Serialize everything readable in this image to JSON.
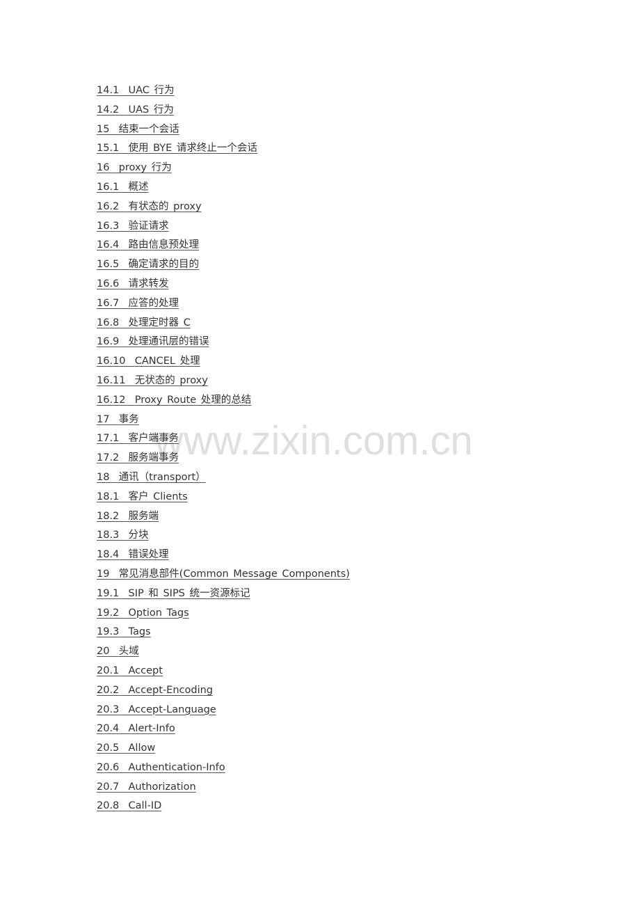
{
  "toc": {
    "items": [
      {
        "number": "14.1",
        "title": "UAC 行为"
      },
      {
        "number": "14.2",
        "title": "UAS 行为"
      },
      {
        "number": "15",
        "title": "结束一个会话"
      },
      {
        "number": "15.1",
        "title": "使用 BYE 请求终止一个会话"
      },
      {
        "number": "16",
        "title": "proxy 行为"
      },
      {
        "number": "16.1",
        "title": "概述"
      },
      {
        "number": "16.2",
        "title": "有状态的 proxy"
      },
      {
        "number": "16.3",
        "title": "验证请求"
      },
      {
        "number": "16.4",
        "title": "路由信息预处理"
      },
      {
        "number": "16.5",
        "title": "确定请求的目的"
      },
      {
        "number": "16.6",
        "title": "请求转发"
      },
      {
        "number": "16.7",
        "title": "应答的处理"
      },
      {
        "number": "16.8",
        "title": "处理定时器 C"
      },
      {
        "number": "16.9",
        "title": "处理通讯层的错误"
      },
      {
        "number": "16.10",
        "title": "CANCEL 处理"
      },
      {
        "number": "16.11",
        "title": "无状态的 proxy"
      },
      {
        "number": "16.12",
        "title": "Proxy Route 处理的总结"
      },
      {
        "number": "17",
        "title": "事务"
      },
      {
        "number": "17.1",
        "title": "客户端事务"
      },
      {
        "number": "17.2",
        "title": "服务端事务"
      },
      {
        "number": "18",
        "title": "通讯（transport）"
      },
      {
        "number": "18.1",
        "title": "客户 Clients"
      },
      {
        "number": "18.2",
        "title": "服务端"
      },
      {
        "number": "18.3",
        "title": "分块"
      },
      {
        "number": "18.4",
        "title": "错误处理"
      },
      {
        "number": "19",
        "title": "常见消息部件(Common Message Components)"
      },
      {
        "number": "19.1",
        "title": "SIP 和 SIPS 统一资源标记"
      },
      {
        "number": "19.2",
        "title": "Option Tags"
      },
      {
        "number": "19.3",
        "title": "Tags"
      },
      {
        "number": "20",
        "title": "头域"
      },
      {
        "number": "20.1",
        "title": "Accept"
      },
      {
        "number": "20.2",
        "title": "Accept-Encoding"
      },
      {
        "number": "20.3",
        "title": "Accept-Language"
      },
      {
        "number": "20.4",
        "title": "Alert-Info"
      },
      {
        "number": "20.5",
        "title": "Allow"
      },
      {
        "number": "20.6",
        "title": "Authentication-Info"
      },
      {
        "number": "20.7",
        "title": "Authorization"
      },
      {
        "number": "20.8",
        "title": "Call-ID"
      }
    ]
  },
  "watermark": {
    "text": "www.zixin.com.cn"
  },
  "colors": {
    "text": "#333333",
    "background": "#ffffff"
  }
}
